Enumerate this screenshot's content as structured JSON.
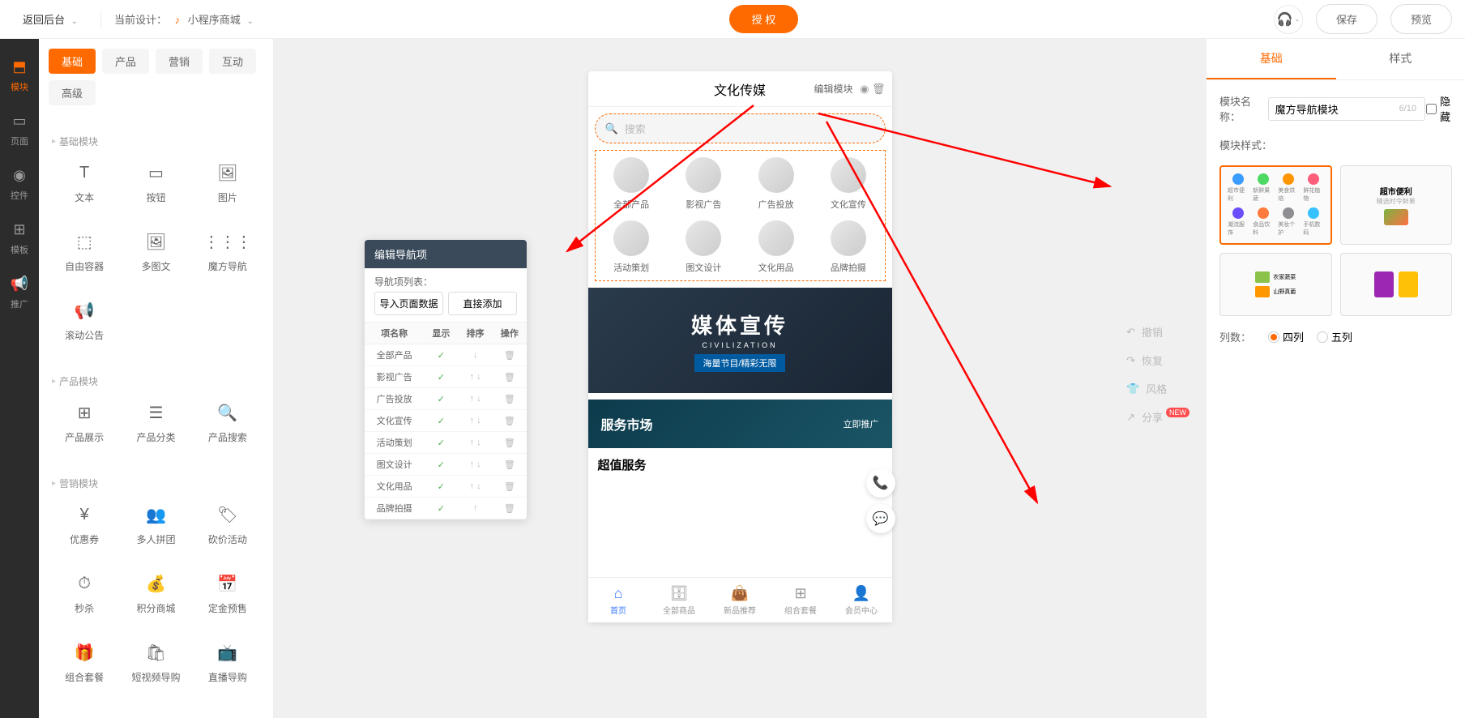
{
  "topbar": {
    "back": "返回后台",
    "current_design_prefix": "当前设计：",
    "current_design_name": "小程序商城",
    "auth_btn": "授 权",
    "save_btn": "保存",
    "preview_btn": "预览"
  },
  "leftrail": [
    {
      "icon": "⬒",
      "label": "模块"
    },
    {
      "icon": "▭",
      "label": "页面"
    },
    {
      "icon": "◉",
      "label": "控件"
    },
    {
      "icon": "⊞",
      "label": "模板"
    },
    {
      "icon": "📢",
      "label": "推广"
    }
  ],
  "mod_tabs": [
    "基础",
    "产品",
    "营销",
    "互动",
    "高级"
  ],
  "mod_sections": [
    {
      "title": "基础模块",
      "items": [
        {
          "icon": "T",
          "label": "文本"
        },
        {
          "icon": "▭",
          "label": "按钮"
        },
        {
          "icon": "🖼",
          "label": "图片"
        },
        {
          "icon": "⬚",
          "label": "自由容器"
        },
        {
          "icon": "🖼",
          "label": "多图文"
        },
        {
          "icon": "⋮⋮⋮",
          "label": "魔方导航"
        },
        {
          "icon": "📢",
          "label": "滚动公告"
        }
      ]
    },
    {
      "title": "产品模块",
      "items": [
        {
          "icon": "⊞",
          "label": "产品展示"
        },
        {
          "icon": "☰",
          "label": "产品分类"
        },
        {
          "icon": "🔍",
          "label": "产品搜索"
        }
      ]
    },
    {
      "title": "营销模块",
      "items": [
        {
          "icon": "¥",
          "label": "优惠券"
        },
        {
          "icon": "👥",
          "label": "多人拼团"
        },
        {
          "icon": "🏷",
          "label": "砍价活动"
        },
        {
          "icon": "⏱",
          "label": "秒杀"
        },
        {
          "icon": "💰",
          "label": "积分商城"
        },
        {
          "icon": "📅",
          "label": "定金预售"
        },
        {
          "icon": "🎁",
          "label": "组合套餐"
        },
        {
          "icon": "🛍",
          "label": "短视频导购"
        },
        {
          "icon": "📺",
          "label": "直播导购"
        }
      ]
    }
  ],
  "phone": {
    "title": "文化传媒",
    "edit_module": "编辑模块",
    "search_placeholder": "搜索",
    "nav_items": [
      "全部产品",
      "影视广告",
      "广告投放",
      "文化宣传",
      "活动策划",
      "图文设计",
      "文化用品",
      "品牌拍摄"
    ],
    "banner_big": "媒体宣传",
    "banner_sub": "CIVILIZATION",
    "banner_tag": "海量节目/精彩无限",
    "service_title": "服务市场",
    "service_btn": "立即推广",
    "section_title": "超值服务",
    "tabbar": [
      {
        "icon": "⌂",
        "label": "首页"
      },
      {
        "icon": "🗄",
        "label": "全部商品"
      },
      {
        "icon": "👜",
        "label": "新品推荐"
      },
      {
        "icon": "⊞",
        "label": "组合套餐"
      },
      {
        "icon": "👤",
        "label": "会员中心"
      }
    ]
  },
  "edit_popup": {
    "title": "编辑导航项",
    "subtitle": "导航项列表：",
    "btn_import": "导入页面数据",
    "btn_add": "直接添加",
    "headers": [
      "项名称",
      "显示",
      "排序",
      "操作"
    ],
    "rows": [
      {
        "name": "全部产品",
        "up": false,
        "down": true
      },
      {
        "name": "影视广告",
        "up": true,
        "down": true
      },
      {
        "name": "广告投放",
        "up": true,
        "down": true
      },
      {
        "name": "文化宣传",
        "up": true,
        "down": true
      },
      {
        "name": "活动策划",
        "up": true,
        "down": true
      },
      {
        "name": "图文设计",
        "up": true,
        "down": true
      },
      {
        "name": "文化用品",
        "up": true,
        "down": true
      },
      {
        "name": "品牌拍摄",
        "up": true,
        "down": false
      }
    ]
  },
  "canvas_actions": [
    {
      "icon": "↶",
      "label": "撤销"
    },
    {
      "icon": "↷",
      "label": "恢复"
    },
    {
      "icon": "👕",
      "label": "风格"
    },
    {
      "icon": "↗",
      "label": "分享",
      "badge": "NEW"
    }
  ],
  "right_panel": {
    "tabs": [
      "基础",
      "样式"
    ],
    "name_label": "模块名称：",
    "name_value": "魔方导航模块",
    "name_count": "6/10",
    "hide_label": "隐藏",
    "style_label": "模块样式：",
    "style_mini_icons": [
      [
        {
          "c": "#3a9cff",
          "l": "超市便利"
        },
        {
          "c": "#4cd964",
          "l": "新鲜果蔬"
        },
        {
          "c": "#ff9500",
          "l": "美食烘焙"
        },
        {
          "c": "#ff5e7a",
          "l": "鲜花植物"
        }
      ],
      [
        {
          "c": "#6b4efc",
          "l": "潮流服饰"
        },
        {
          "c": "#ff7a3d",
          "l": "食品饮料"
        },
        {
          "c": "#8e8e93",
          "l": "美妆个护"
        },
        {
          "c": "#36c2ff",
          "l": "手机数码"
        }
      ]
    ],
    "style_opt2_title": "超市便利",
    "style_opt2_sub": "精选时令鲜果",
    "columns_label": "列数：",
    "columns_options": [
      "四列",
      "五列"
    ]
  }
}
